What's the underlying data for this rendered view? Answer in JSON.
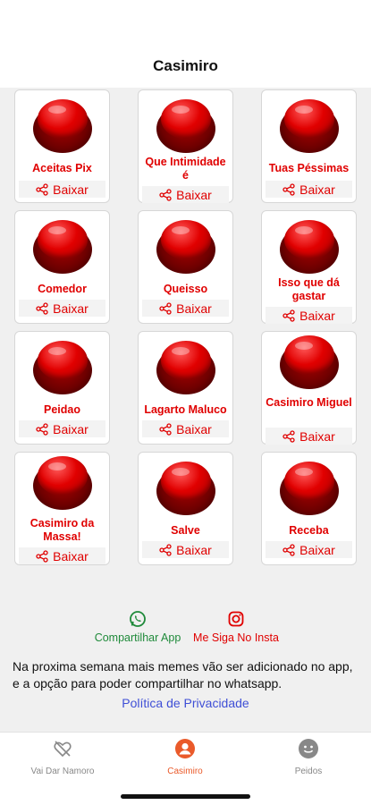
{
  "header": {
    "title": "Casimiro"
  },
  "buttons": [
    {
      "label": "Aceitas Pix",
      "download": "Baixar"
    },
    {
      "label": "Que Intimidade é",
      "download": "Baixar"
    },
    {
      "label": "Tuas Péssimas",
      "download": "Baixar"
    },
    {
      "label": "Comedor",
      "download": "Baixar"
    },
    {
      "label": "Queisso",
      "download": "Baixar"
    },
    {
      "label": "Isso que dá gastar",
      "download": "Baixar"
    },
    {
      "label": "Peidao",
      "download": "Baixar"
    },
    {
      "label": "Lagarto Maluco",
      "download": "Baixar"
    },
    {
      "label": "Casimiro Miguel",
      "download": "Baixar"
    },
    {
      "label": "Casimiro da Massa!",
      "download": "Baixar"
    },
    {
      "label": "Salve",
      "download": "Baixar"
    },
    {
      "label": "Receba",
      "download": "Baixar"
    }
  ],
  "links": {
    "share_app": "Compartilhar App",
    "instagram": "Me Siga No Insta"
  },
  "info": {
    "text": "Na proxima semana mais memes vão ser adicionado no app, e a opção para poder compartilhar no whatsapp.",
    "privacy": "Política de Privacidade"
  },
  "tabs": [
    {
      "label": "Vai Dar Namoro",
      "icon": "heart-icon"
    },
    {
      "label": "Casimiro",
      "icon": "user-circle-icon"
    },
    {
      "label": "Peidos",
      "icon": "smiley-icon"
    }
  ],
  "colors": {
    "accent_red": "#e00000",
    "tab_active": "#ea5a2a",
    "whatsapp_green": "#1f8a3a",
    "link_blue": "#3f4fd6"
  }
}
